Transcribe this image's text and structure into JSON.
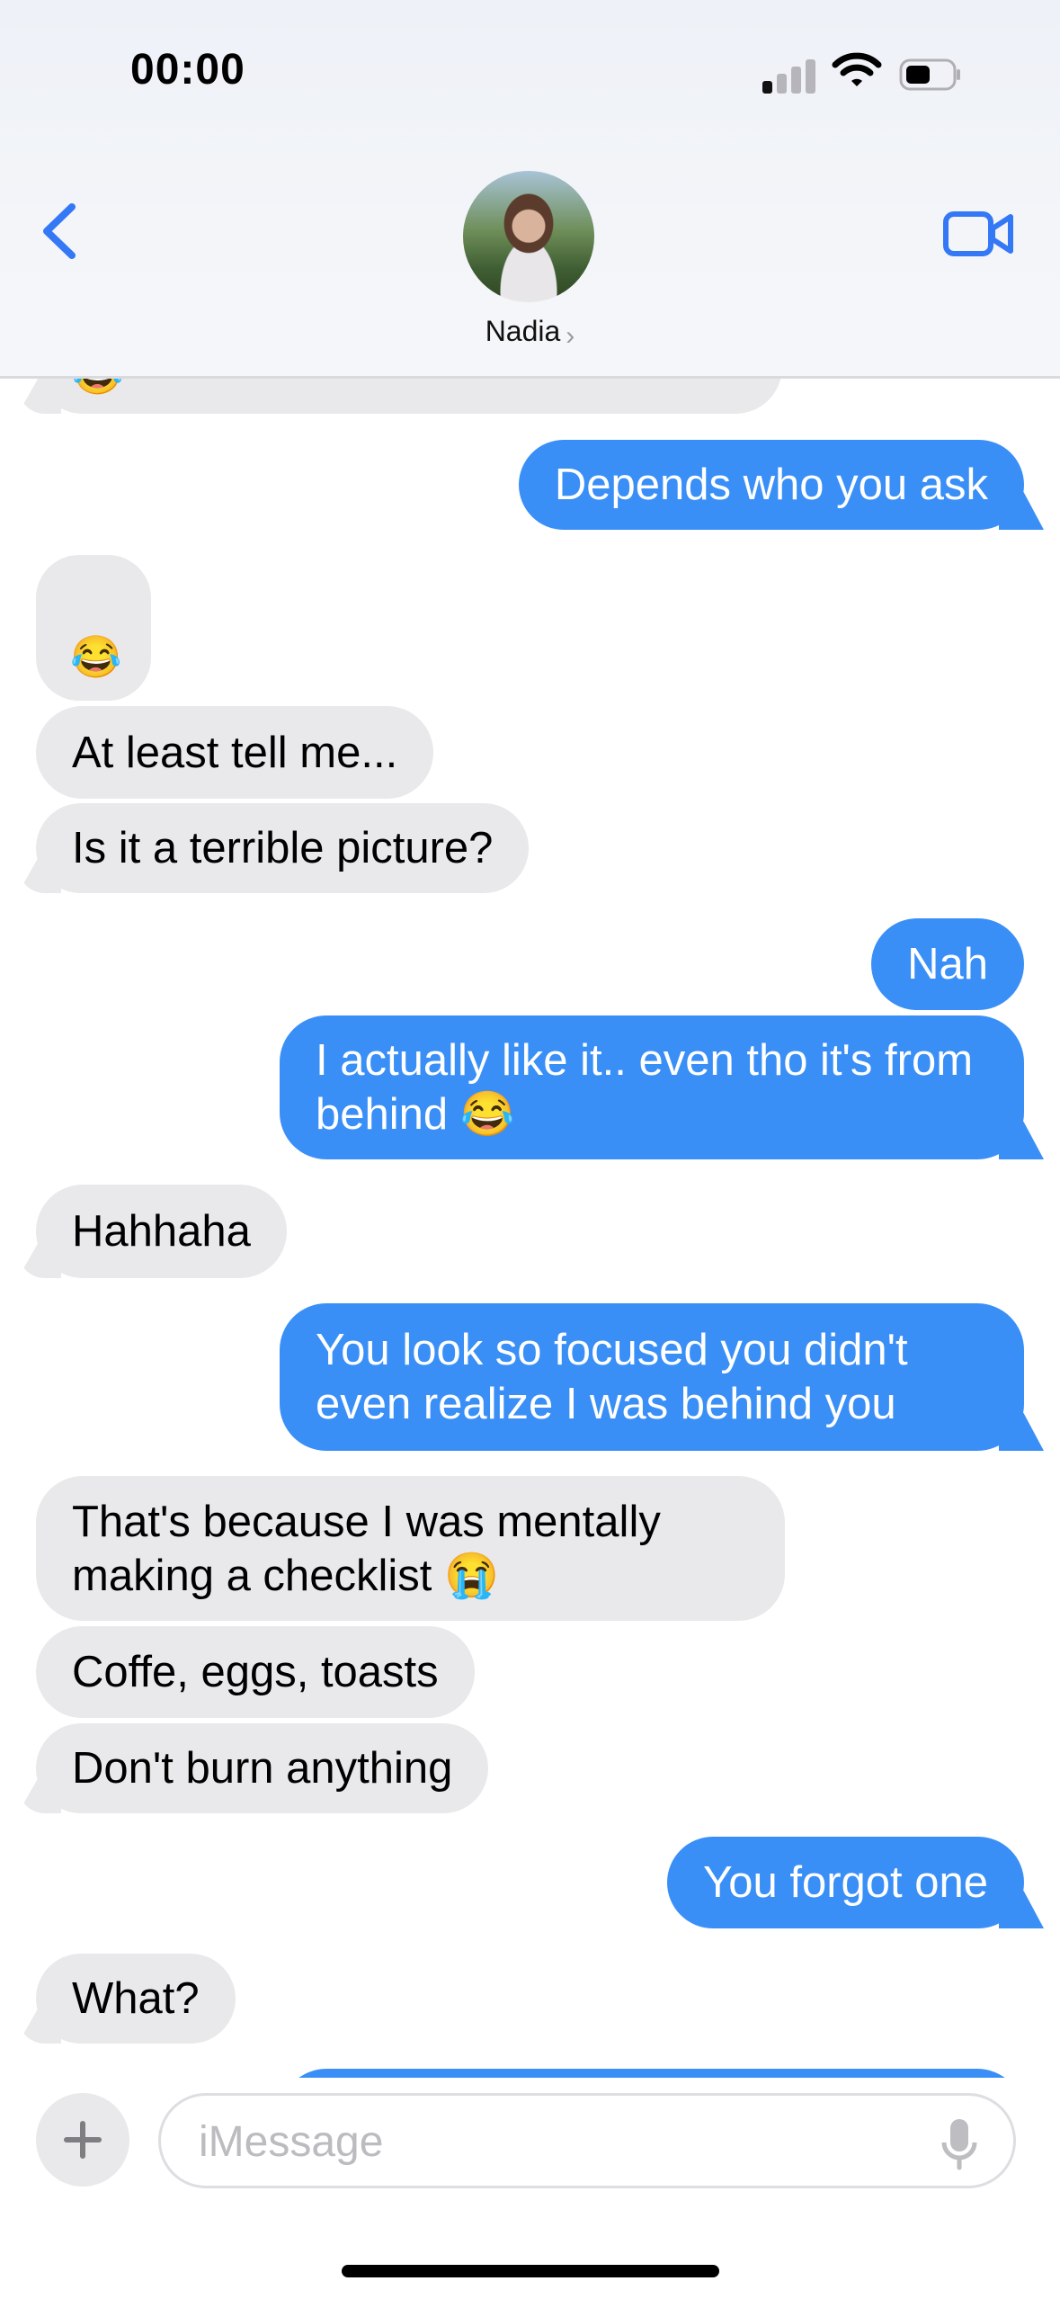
{
  "status_bar": {
    "time": "00:00"
  },
  "header": {
    "contact_name": "Nadia",
    "back_icon": "chevron-left-icon",
    "video_icon": "video-camera-icon"
  },
  "messages": [
    {
      "from": "them",
      "text": "😂"
    },
    {
      "from": "me",
      "text": "Depends who you ask"
    },
    {
      "from": "them",
      "text": "😂"
    },
    {
      "from": "them",
      "text": "At least tell me..."
    },
    {
      "from": "them",
      "text": "Is it a terrible picture?"
    },
    {
      "from": "me",
      "text": "Nah"
    },
    {
      "from": "me",
      "text": "I actually like it.. even tho it's from behind 😂"
    },
    {
      "from": "them",
      "text": "Hahhaha"
    },
    {
      "from": "me",
      "text": "You look so focused you didn't even realize I was behind you"
    },
    {
      "from": "them",
      "text": "That's because I was mentally making a checklist 😭"
    },
    {
      "from": "them",
      "text": "Coffe, eggs, toasts"
    },
    {
      "from": "them",
      "text": "Don't burn anything"
    },
    {
      "from": "me",
      "text": "You forgot one"
    },
    {
      "from": "them",
      "text": "What?"
    }
  ],
  "composer": {
    "placeholder": "iMessage",
    "plus_icon": "plus-icon",
    "mic_icon": "microphone-icon"
  },
  "colors": {
    "outgoing": "#3a8ff7",
    "incoming": "#e9e9eb",
    "accent": "#3478f6"
  }
}
